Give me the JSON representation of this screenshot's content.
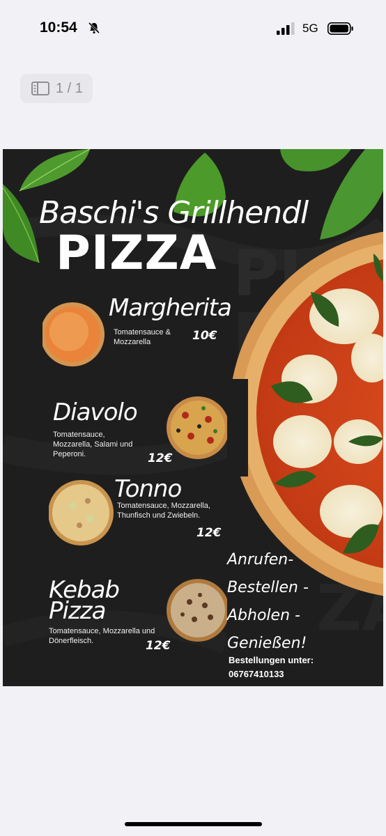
{
  "status_bar": {
    "time": "10:54",
    "network": "5G"
  },
  "viewer": {
    "page_indicator": "1 / 1"
  },
  "flyer": {
    "brand": "Baschi's Grillhendl",
    "heading": "PIZZA",
    "pizzas": [
      {
        "name": "Margherita",
        "description": "Tomatensauce & Mozzarella",
        "price": "10€"
      },
      {
        "name": "Diavolo",
        "description": "Tomatensauce, Mozzarella, Salami und Peperoni.",
        "price": "12€"
      },
      {
        "name": "Tonno",
        "description": "Tomatensauce, Mozzarella, Thunfisch und Zwiebeln.",
        "price": "12€"
      },
      {
        "name": "Kebab Pizza",
        "description": "Tomatensauce, Mozzarella und Dönerfleisch.",
        "price": "12€"
      }
    ],
    "cta_lines": [
      "Anrufen-",
      "Bestellen -",
      "Abholen -",
      "Genießen!"
    ],
    "order_label": "Bestellungen unter:",
    "phone": "06767410133"
  },
  "icons": {
    "bell": "bell-slash-icon",
    "signal": "cellular-signal-icon",
    "battery": "battery-icon",
    "page": "document-pages-icon"
  }
}
